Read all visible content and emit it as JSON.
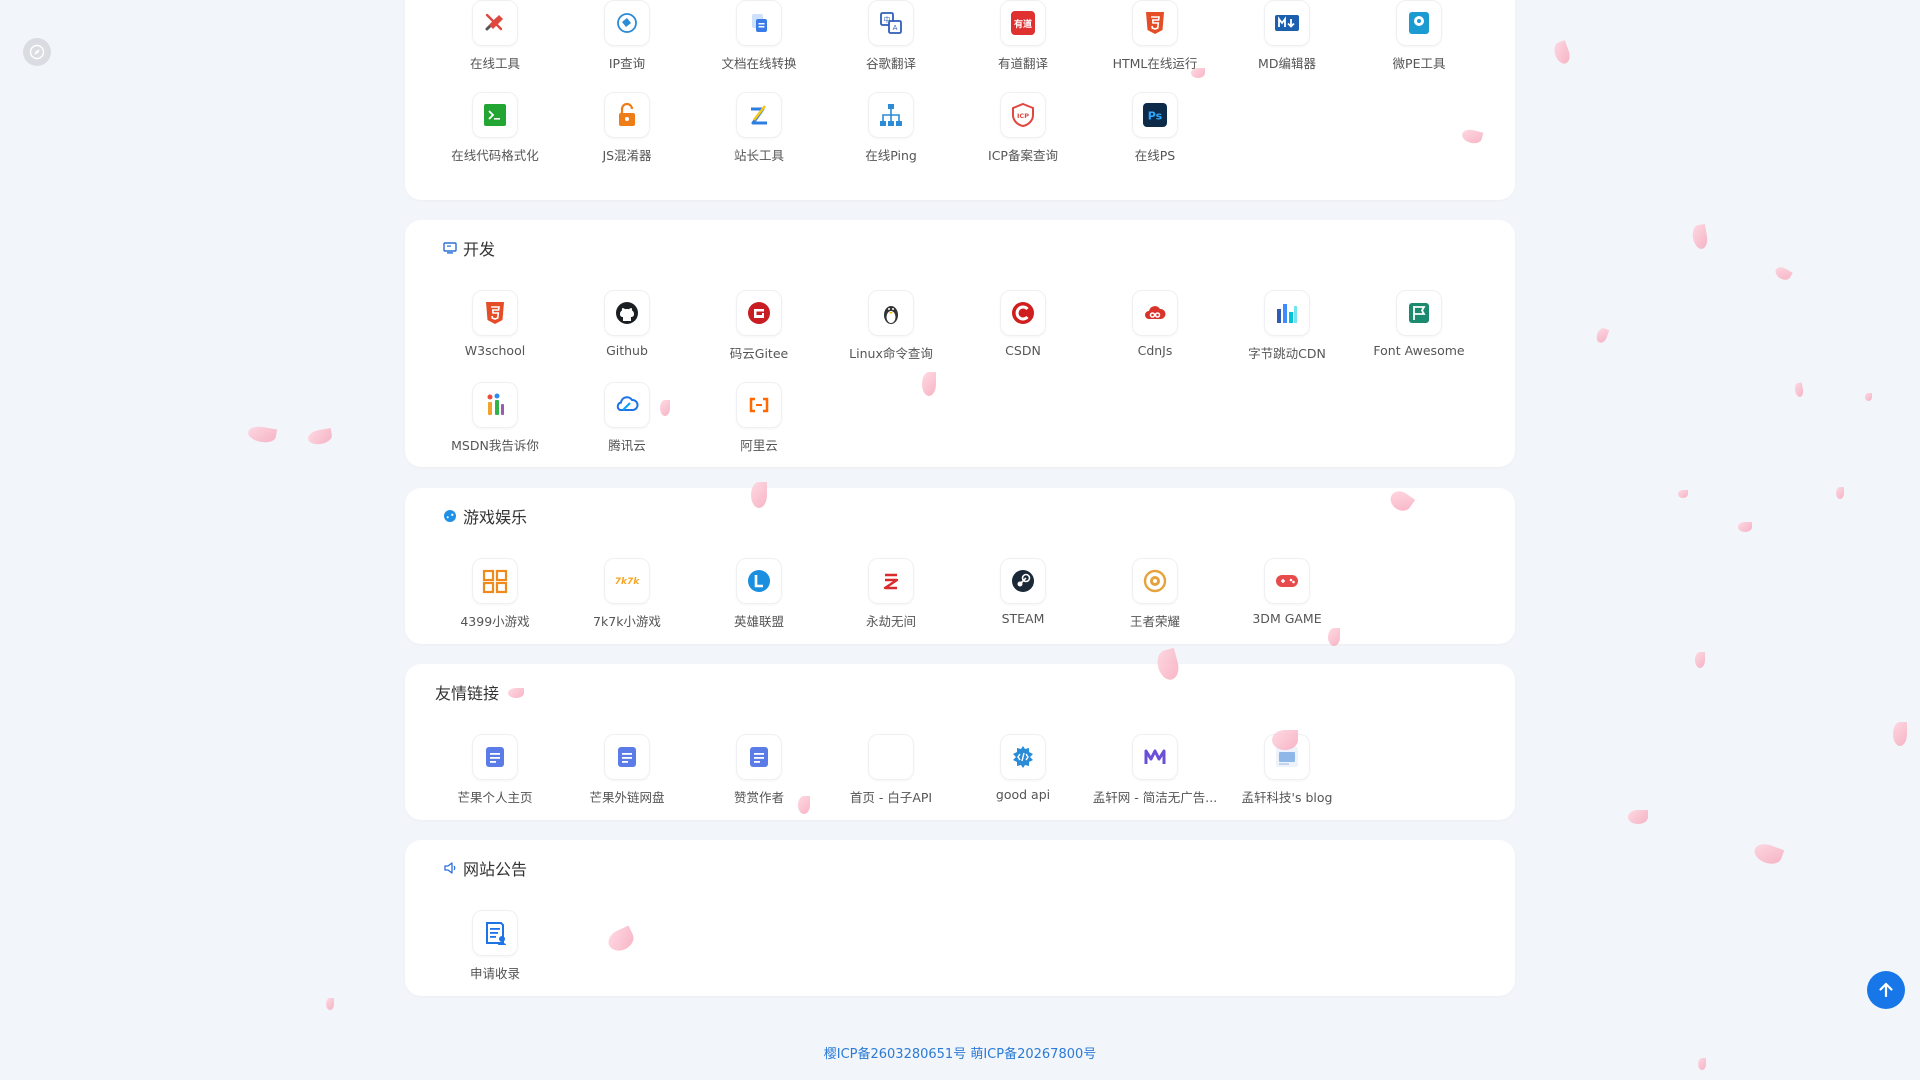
{
  "sections": [
    {
      "id": "tools",
      "title": "",
      "items": [
        {
          "label": "在线工具",
          "icon": "wrench-screwdriver-icon",
          "color": "#e0483f"
        },
        {
          "label": "IP查询",
          "icon": "ip-globe-icon",
          "color": "#2a8bd6"
        },
        {
          "label": "文档在线转换",
          "icon": "document-convert-icon",
          "color": "#3a7be8"
        },
        {
          "label": "谷歌翻译",
          "icon": "google-translate-icon",
          "color": "#2f5fb8"
        },
        {
          "label": "有道翻译",
          "icon": "youdao-logo-icon",
          "color": "#e03131"
        },
        {
          "label": "HTML在线运行",
          "icon": "html5-icon",
          "color": "#e44d26"
        },
        {
          "label": "MD编辑器",
          "icon": "markdown-icon",
          "color": "#1b5fae"
        },
        {
          "label": "微PE工具",
          "icon": "wepe-disk-icon",
          "color": "#1b9bd1"
        },
        {
          "label": "在线代码格式化",
          "icon": "terminal-icon",
          "color": "#23a534"
        },
        {
          "label": "JS混淆器",
          "icon": "padlock-open-icon",
          "color": "#ef7d17"
        },
        {
          "label": "站长工具",
          "icon": "zhanzhang-logo-icon",
          "color": "#2d7ee3"
        },
        {
          "label": "在线Ping",
          "icon": "network-tree-icon",
          "color": "#2a8bd6"
        },
        {
          "label": "ICP备案查询",
          "icon": "icp-shield-icon",
          "color": "#e0483f"
        },
        {
          "label": "在线PS",
          "icon": "photoshop-icon",
          "color": "#0d2b48"
        }
      ]
    },
    {
      "id": "dev",
      "title": "开发",
      "icon": "monitor-icon",
      "items": [
        {
          "label": "W3school",
          "icon": "html5-icon",
          "color": "#e44d26"
        },
        {
          "label": "Github",
          "icon": "github-icon",
          "color": "#1b1f23"
        },
        {
          "label": "码云Gitee",
          "icon": "gitee-icon",
          "color": "#c71d23"
        },
        {
          "label": "Linux命令查询",
          "icon": "tux-penguin-icon",
          "color": "#333333"
        },
        {
          "label": "CSDN",
          "icon": "csdn-icon",
          "color": "#d01d1d"
        },
        {
          "label": "CdnJs",
          "icon": "cloud-link-icon",
          "color": "#d9342b"
        },
        {
          "label": "字节跳动CDN",
          "icon": "bytedance-icon",
          "color": "#325ab4"
        },
        {
          "label": "Font Awesome",
          "icon": "flag-icon",
          "color": "#1b8a6e"
        },
        {
          "label": "MSDN我告诉你",
          "icon": "msdn-icon",
          "color": "#f0a22a"
        },
        {
          "label": "腾讯云",
          "icon": "tencent-cloud-icon",
          "color": "#1e74e5"
        },
        {
          "label": "阿里云",
          "icon": "aliyun-icon",
          "color": "#ff6a00"
        }
      ]
    },
    {
      "id": "games",
      "title": "游戏娱乐",
      "icon": "gamepad-icon",
      "items": [
        {
          "label": "4399小游戏",
          "icon": "4399-logo-icon",
          "color": "#f08a1c"
        },
        {
          "label": "7k7k小游戏",
          "icon": "7k7k-logo-icon",
          "color": "#f5a623"
        },
        {
          "label": "英雄联盟",
          "icon": "lol-logo-icon",
          "color": "#1a8fe0"
        },
        {
          "label": "永劫无间",
          "icon": "naraka-logo-icon",
          "color": "#d92b2b"
        },
        {
          "label": "STEAM",
          "icon": "steam-icon",
          "color": "#1b2838"
        },
        {
          "label": "王者荣耀",
          "icon": "honor-of-kings-icon",
          "color": "#e6a23c"
        },
        {
          "label": "3DM GAME",
          "icon": "3dm-gamepad-icon",
          "color": "#e84b4b"
        }
      ]
    },
    {
      "id": "links",
      "title": "友情链接",
      "items": [
        {
          "label": "芒果个人主页",
          "icon": "doc-page-icon",
          "color": "#5b7ce6"
        },
        {
          "label": "芒果外链网盘",
          "icon": "doc-page-icon",
          "color": "#5b7ce6"
        },
        {
          "label": "赞赏作者",
          "icon": "doc-page-icon",
          "color": "#5b7ce6"
        },
        {
          "label": "首页 - 白子API",
          "icon": "blank-icon",
          "color": "#ffffff"
        },
        {
          "label": "good api",
          "icon": "code-gear-icon",
          "color": "#2a8bd6"
        },
        {
          "label": "孟轩网 - 简洁无广告...",
          "icon": "m-logo-icon",
          "color": "#6b4fd8"
        },
        {
          "label": "孟轩科技's blog",
          "icon": "blog-thumbnail-icon",
          "color": "#8fb7e8"
        }
      ]
    },
    {
      "id": "notice",
      "title": "网站公告",
      "icon": "speaker-icon",
      "items": [
        {
          "label": "申请收录",
          "icon": "apply-form-icon",
          "color": "#1e74e5"
        }
      ]
    }
  ],
  "footer": {
    "icp1": "樱ICP备2603280651号",
    "icp2": "萌ICP备20267800号"
  },
  "colors": {
    "accent": "#1877e8",
    "footer_link": "#2b7bd6",
    "background": "#f2f5f9"
  }
}
